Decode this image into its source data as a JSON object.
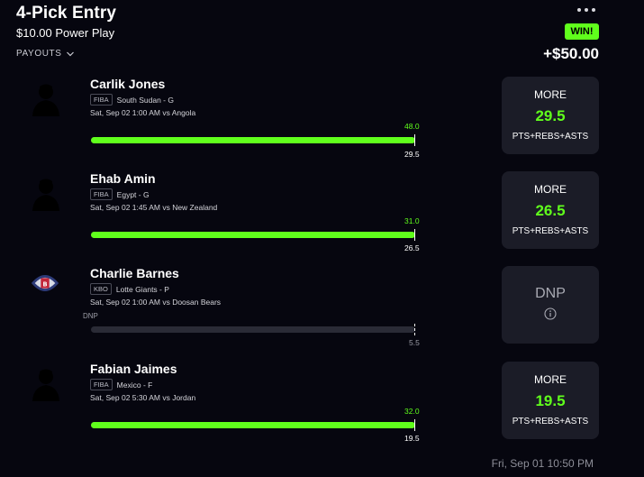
{
  "entry": {
    "title": "4-Pick Entry",
    "subtitle": "$10.00 Power Play",
    "payouts_label": "PAYOUTS",
    "result_badge": "WIN!",
    "payout_amount": "+$50.00",
    "more_icon": "more-horizontal-icon",
    "timestamp": "Fri, Sep 01 10:50 PM"
  },
  "colors": {
    "accent": "#60ff1c",
    "background": "#06060f",
    "card": "#1b1c27",
    "track": "#2a2b36"
  },
  "picks": [
    {
      "name": "Carlik Jones",
      "league": "FIBA",
      "team_pos": "South Sudan - G",
      "game": "Sat, Sep 02 1:00 AM  vs Angola",
      "actual": "48.0",
      "line": "29.5",
      "progress": 1.0,
      "line_position": 1.0,
      "direction": "MORE",
      "stat": "PTS+REBS+ASTS",
      "avatar_icon": "player-silhouette-icon"
    },
    {
      "name": "Ehab Amin",
      "league": "FIBA",
      "team_pos": "Egypt - G",
      "game": "Sat, Sep 02 1:45 AM  vs New Zealand",
      "actual": "31.0",
      "line": "26.5",
      "progress": 1.0,
      "line_position": 1.0,
      "direction": "MORE",
      "stat": "PTS+REBS+ASTS",
      "avatar_icon": "player-silhouette-icon"
    },
    {
      "name": "Charlie Barnes",
      "league": "KBO",
      "team_pos": "Lotte Giants - P",
      "game": "Sat, Sep 02 1:00 AM  vs Doosan Bears",
      "status_label": "DNP",
      "line": "5.5",
      "progress": 0,
      "line_position": 1.0,
      "result": "DNP",
      "info_icon": "info-icon",
      "avatar_icon": "team-logo-icon"
    },
    {
      "name": "Fabian Jaimes",
      "league": "FIBA",
      "team_pos": "Mexico - F",
      "game": "Sat, Sep 02 5:30 AM  vs Jordan",
      "actual": "32.0",
      "line": "19.5",
      "progress": 1.0,
      "line_position": 1.0,
      "direction": "MORE",
      "stat": "PTS+REBS+ASTS",
      "avatar_icon": "player-silhouette-icon"
    }
  ]
}
